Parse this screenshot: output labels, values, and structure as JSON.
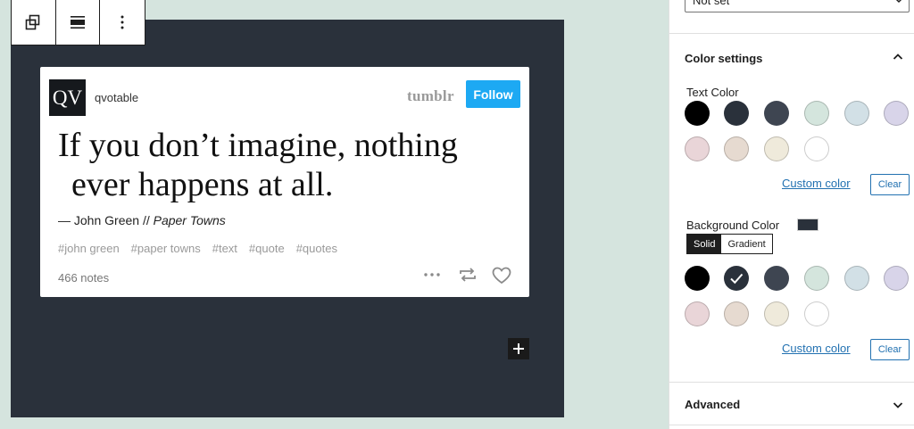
{
  "post": {
    "avatar_text": "QV",
    "blog_name": "qvotable",
    "platform_logo": "tumblr",
    "follow_label": "Follow",
    "quote_line1": "If you don’t imagine, nothing",
    "quote_line2": "ever happens at all.",
    "source_author": "— John Green // ",
    "source_title": "Paper Towns",
    "tags": [
      "#john green",
      "#paper towns",
      "#text",
      "#quote",
      "#quotes"
    ],
    "notes": "466 notes"
  },
  "toolbar": {
    "icons": [
      "transform-icon",
      "align-icon",
      "more-options-icon"
    ]
  },
  "sidebar": {
    "select_value": "Not set",
    "color_settings": {
      "title": "Color settings",
      "text_color": {
        "label": "Text Color",
        "swatches": [
          "#000000",
          "#2a313b",
          "#3e4551",
          "#d4e5dd",
          "#d2e0e6",
          "#d8d4e9",
          "#e9d5d8",
          "#e6dad0",
          "#efeadb",
          "#ffffff"
        ],
        "custom_label": "Custom color",
        "clear_label": "Clear"
      },
      "background_color": {
        "label": "Background Color",
        "current": "#2a313b",
        "tabs": [
          "Solid",
          "Gradient"
        ],
        "active_tab": "Solid",
        "swatches": [
          "#000000",
          "#2a313b",
          "#3e4551",
          "#d4e5dd",
          "#d2e0e6",
          "#d8d4e9",
          "#e9d5d8",
          "#e6dad0",
          "#efeadb",
          "#ffffff"
        ],
        "selected_index": 1,
        "custom_label": "Custom color",
        "clear_label": "Clear"
      }
    },
    "advanced": {
      "title": "Advanced"
    }
  },
  "colors": {
    "canvas_bg": "#d5e4de",
    "block_bg": "#2a313b",
    "follow_blue": "#1da9f3",
    "link_blue": "#2271b1"
  }
}
